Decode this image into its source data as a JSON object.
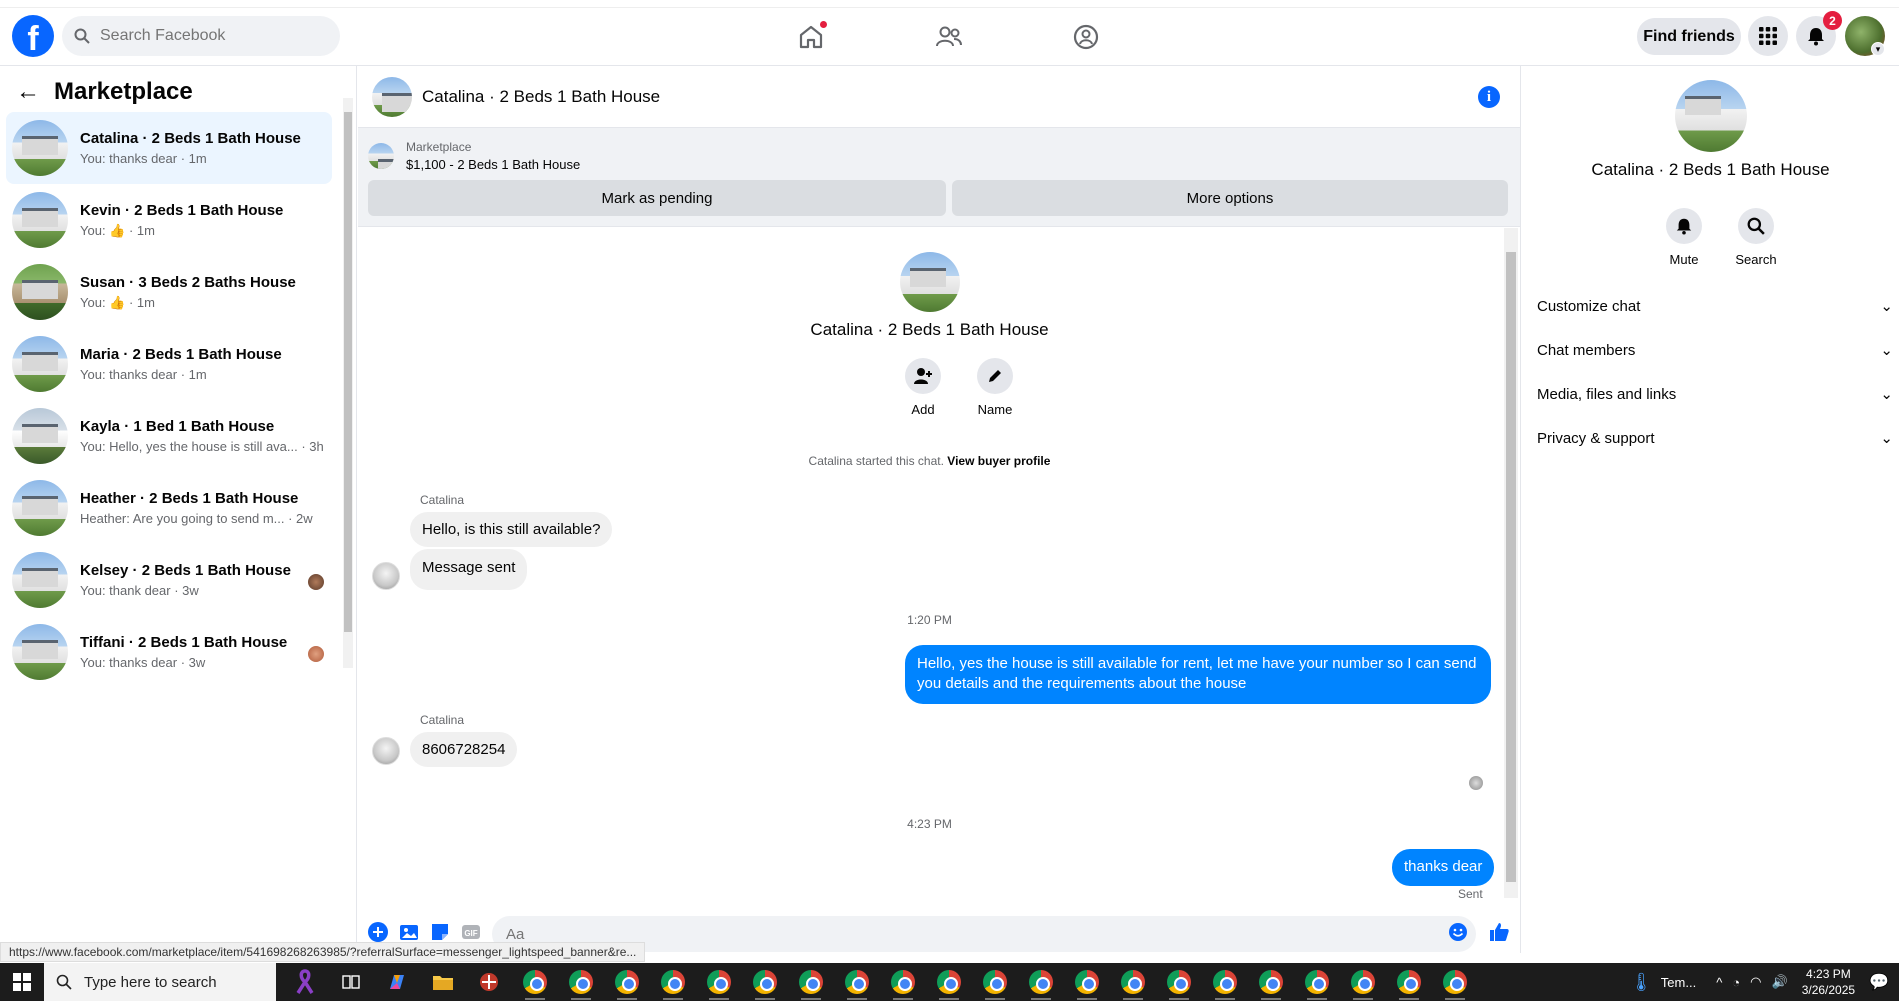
{
  "topnav": {
    "logo": "f",
    "search_placeholder": "Search Facebook",
    "find_friends": "Find friends",
    "notif_count": "2"
  },
  "sidebar": {
    "title": "Marketplace",
    "conversations": [
      {
        "name": "Catalina · 2 Beds 1 Bath House",
        "sub": "You: thanks dear · 1m"
      },
      {
        "name": "Kevin · 2 Beds 1 Bath House",
        "sub": "You: 👍 · 1m"
      },
      {
        "name": "Susan · 3 Beds 2 Baths House",
        "sub": "You: 👍 · 1m"
      },
      {
        "name": "Maria · 2 Beds 1 Bath House",
        "sub": "You: thanks dear · 1m"
      },
      {
        "name": "Kayla · 1 Bed 1 Bath House",
        "sub": "You: Hello, yes the house is still ava... · 3h"
      },
      {
        "name": "Heather · 2 Beds 1 Bath House",
        "sub": "Heather: Are you going to send m... · 2w"
      },
      {
        "name": "Kelsey · 2 Beds 1 Bath House",
        "sub": "You: thank dear · 3w"
      },
      {
        "name": "Tiffani · 2 Beds 1 Bath House",
        "sub": "You: thanks dear · 3w"
      }
    ]
  },
  "chat": {
    "title": "Catalina · 2 Beds 1 Bath House",
    "listing_source": "Marketplace",
    "listing_price_title": "$1,100 - 2 Beds 1 Bath House",
    "mark_pending": "Mark as pending",
    "more_options": "More options",
    "intro_title": "Catalina · 2 Beds 1 Bath House",
    "add_label": "Add",
    "name_label": "Name",
    "started_text": "Catalina started this chat.",
    "view_buyer": "View buyer profile",
    "sender1": "Catalina",
    "msg1": "Hello, is this still available?",
    "msg2": "Message sent",
    "time1": "1:20 PM",
    "msg3": "Hello, yes the house is still available for rent, let me have your number so I can send you details and the requirements about the house",
    "sender2": "Catalina",
    "msg4": "8606728254",
    "time2": "4:23 PM",
    "msg5": "thanks dear",
    "sent_label": "Sent",
    "composer_placeholder": "Aa"
  },
  "rpanel": {
    "title": "Catalina · 2 Beds 1 Bath House",
    "mute": "Mute",
    "search": "Search",
    "sections": [
      "Customize chat",
      "Chat members",
      "Media, files and links",
      "Privacy & support"
    ]
  },
  "url_tooltip": "https://www.facebook.com/marketplace/item/541698268263985/?referralSurface=messenger_lightspeed_banner&re...",
  "taskbar": {
    "search_placeholder": "Type here to search",
    "weather": "Tem...",
    "time": "4:23 PM",
    "date": "3/26/2025"
  }
}
